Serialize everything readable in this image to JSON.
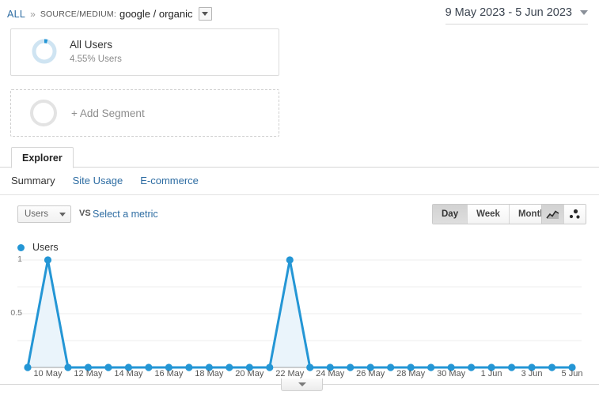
{
  "breadcrumb": {
    "root_label": "ALL",
    "separator": "»",
    "dimension_label": "SOURCE/MEDIUM:",
    "dimension_value": "google / organic"
  },
  "date_range": {
    "label": "9 May 2023 - 5 Jun 2023"
  },
  "segments": [
    {
      "title": "All Users",
      "subtitle": "4.55% Users",
      "percent": 4.55,
      "ring_color": "#cfe4f2",
      "segment_color": "#2496d5"
    }
  ],
  "add_segment": {
    "label": "+ Add Segment"
  },
  "tabs": {
    "active_tab": "Explorer"
  },
  "subtabs": [
    {
      "label": "Summary",
      "active": true
    },
    {
      "label": "Site Usage",
      "active": false
    },
    {
      "label": "E-commerce",
      "active": false
    }
  ],
  "controls": {
    "metric_selected": "Users",
    "vs_label": "VS",
    "select_metric_label": "Select a metric",
    "granularity": [
      {
        "label": "Day",
        "active": true
      },
      {
        "label": "Week",
        "active": false
      },
      {
        "label": "Month",
        "active": false
      }
    ],
    "chart_types": [
      {
        "name": "line-chart-icon",
        "active": true
      },
      {
        "name": "motion-chart-icon",
        "active": false
      }
    ]
  },
  "chart_data": {
    "type": "line",
    "title": "",
    "xlabel": "",
    "ylabel": "Users",
    "legend": [
      "Users"
    ],
    "legend_position": "top-left",
    "grid": true,
    "ylim": [
      0,
      1
    ],
    "yticks": [
      0.5,
      1
    ],
    "ytick_labels": [
      "0.5",
      "1"
    ],
    "series_color": "#2496d5",
    "fill_color": "#eaf4fb",
    "x": [
      "9 May",
      "10 May",
      "11 May",
      "12 May",
      "13 May",
      "14 May",
      "15 May",
      "16 May",
      "17 May",
      "18 May",
      "19 May",
      "20 May",
      "21 May",
      "22 May",
      "23 May",
      "24 May",
      "25 May",
      "26 May",
      "27 May",
      "28 May",
      "29 May",
      "30 May",
      "31 May",
      "1 Jun",
      "2 Jun",
      "3 Jun",
      "4 Jun",
      "5 Jun"
    ],
    "xtick_labels": [
      "10 May",
      "12 May",
      "14 May",
      "16 May",
      "18 May",
      "20 May",
      "22 May",
      "24 May",
      "26 May",
      "28 May",
      "30 May",
      "1 Jun",
      "3 Jun",
      "5 Jun"
    ],
    "xtick_indices": [
      1,
      3,
      5,
      7,
      9,
      11,
      13,
      15,
      17,
      19,
      21,
      23,
      25,
      27
    ],
    "series": [
      {
        "name": "Users",
        "values": [
          0,
          1,
          0,
          0,
          0,
          0,
          0,
          0,
          0,
          0,
          0,
          0,
          0,
          1,
          0,
          0,
          0,
          0,
          0,
          0,
          0,
          0,
          0,
          0,
          0,
          0,
          0,
          0
        ]
      }
    ]
  },
  "bottom": {
    "collapse_icon": "chevron-down-icon"
  }
}
